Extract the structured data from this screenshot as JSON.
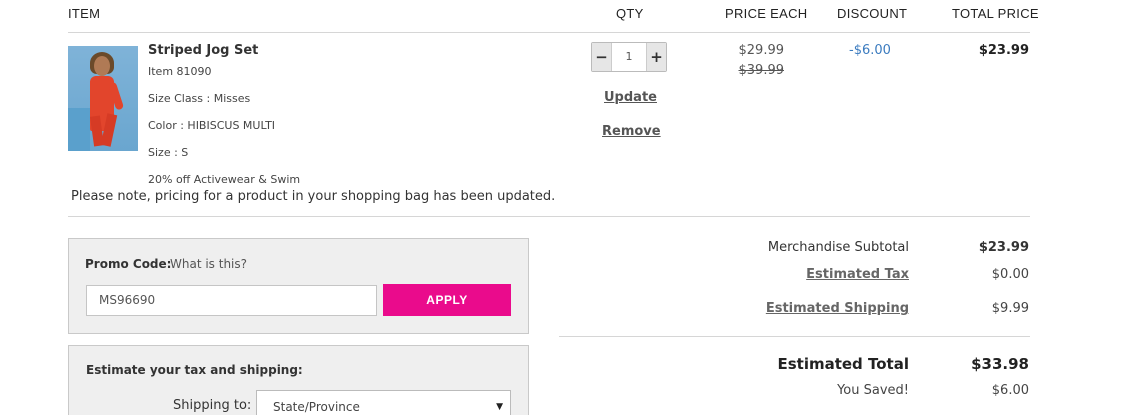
{
  "headers": {
    "item": "ITEM",
    "qty": "QTY",
    "price_each": "PRICE EACH",
    "discount": "DISCOUNT",
    "total_price": "TOTAL PRICE"
  },
  "product": {
    "name": "Striped Jog Set",
    "item_number": "Item 81090",
    "size_class": "Size Class : Misses",
    "color": "Color : HIBISCUS MULTI",
    "size": "Size : S",
    "promo_note": "20% off Activewear & Swim",
    "quantity": "1",
    "price_each": "$29.99",
    "original_price": "$39.99",
    "discount": "-$6.00",
    "total": "$23.99"
  },
  "stepper": {
    "minus": "−",
    "plus": "+"
  },
  "actions": {
    "update": "Update",
    "remove": "Remove"
  },
  "notice": "Please note, pricing for a product in your shopping bag has been updated.",
  "promo": {
    "label": "Promo Code:",
    "help_link": "What is this?",
    "code_value": "MS96690",
    "apply_label": "APPLY"
  },
  "estimate": {
    "title": "Estimate your tax and shipping:",
    "shipping_label": "Shipping to:",
    "state_selected": "State/Province"
  },
  "summary": {
    "subtotal_label": "Merchandise Subtotal",
    "subtotal": "$23.99",
    "tax_label": "Estimated Tax",
    "tax": "$0.00",
    "shipping_label": "Estimated Shipping",
    "shipping": "$9.99",
    "total_label": "Estimated Total",
    "total": "$33.98",
    "saved_label": "You Saved!",
    "saved": "$6.00"
  },
  "colors": {
    "apply_button": "#ea0b8c",
    "discount_text": "#3b7bbf"
  }
}
